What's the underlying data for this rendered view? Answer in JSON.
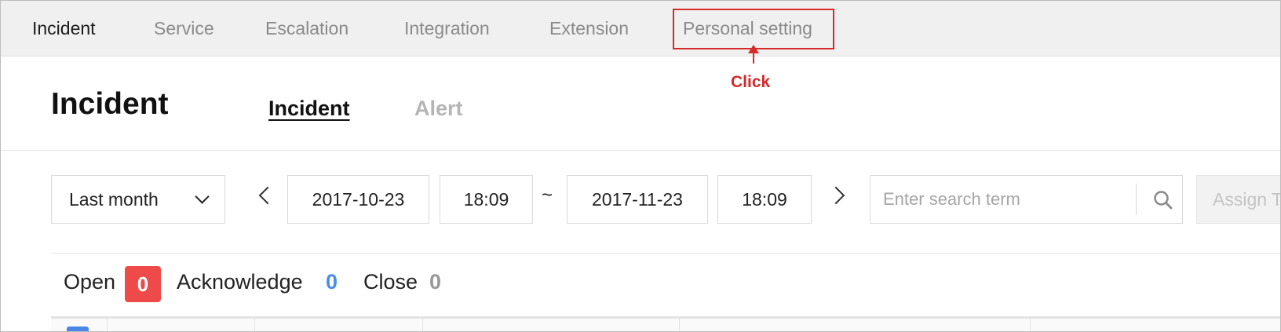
{
  "topnav": {
    "items": [
      {
        "label": "Incident",
        "active": true
      },
      {
        "label": "Service",
        "active": false
      },
      {
        "label": "Escalation",
        "active": false
      },
      {
        "label": "Integration",
        "active": false
      },
      {
        "label": "Extension",
        "active": false
      },
      {
        "label": "Personal setting",
        "active": false
      }
    ]
  },
  "annotation": {
    "click_label": "Click",
    "color": "#d42a2a"
  },
  "header": {
    "title": "Incident",
    "tabs": [
      {
        "label": "Incident",
        "active": true
      },
      {
        "label": "Alert",
        "active": false
      }
    ]
  },
  "filters": {
    "period": "Last month",
    "start_date": "2017-10-23",
    "start_time": "18:09",
    "range_separator": "~",
    "end_date": "2017-11-23",
    "end_time": "18:09",
    "search_placeholder": "Enter search term",
    "assign_label": "Assign T"
  },
  "status": {
    "open_label": "Open",
    "open_count": "0",
    "acknowledge_label": "Acknowledge",
    "acknowledge_count": "0",
    "close_label": "Close",
    "close_count": "0"
  },
  "colors": {
    "badge_red": "#ef4a4a",
    "acknowledge_blue": "#4a8de8",
    "checkbox_blue": "#4a86e8"
  },
  "icons": [
    "chevron-down-icon",
    "chevron-left-icon",
    "chevron-right-icon",
    "search-icon"
  ]
}
